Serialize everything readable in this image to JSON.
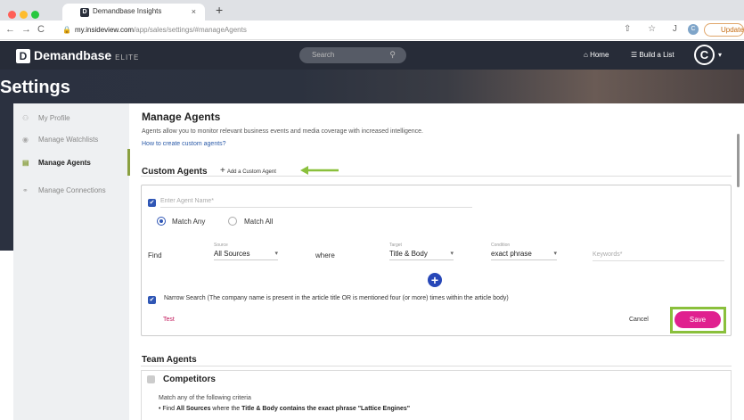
{
  "browser": {
    "tab_title": "Demandbase Insights",
    "tab_favicon": "D",
    "close_tab": "×",
    "new_tab": "+",
    "back_icon": "←",
    "forward_icon": "→",
    "reload_icon": "C",
    "lock_icon": "🔒",
    "url_domain": "my.insideview.com",
    "url_path": "/app/sales/settings/#manageAgents",
    "toolbar_icons": "⇧ ☆ J ♦",
    "profile_initial": "C",
    "update_label": "Update",
    "dot_colors": [
      "#ff5f57",
      "#febc2e",
      "#28c840"
    ]
  },
  "app": {
    "logo_mark": "D",
    "logo_text": "Demandbase",
    "logo_edition": "ELITE",
    "search_placeholder": "Search",
    "search_icon": "⚲",
    "home_icon": "⌂",
    "home_label": "Home",
    "list_icon": "☰",
    "build_label": "Build a List",
    "avatar_initial": "C",
    "avatar_caret": "▾",
    "page_title": "Settings"
  },
  "sidebar": {
    "items": [
      {
        "icon": "user-gear-icon",
        "glyph": "⚇",
        "label": "My Profile"
      },
      {
        "icon": "eye-icon",
        "glyph": "◉",
        "label": "Manage Watchlists"
      },
      {
        "icon": "agents-icon",
        "glyph": "▤",
        "label": "Manage Agents"
      },
      {
        "icon": "connections-icon",
        "glyph": "⚭",
        "label": "Manage Connections"
      }
    ]
  },
  "main": {
    "title": "Manage Agents",
    "description": "Agents allow you to monitor relevant business events and media coverage with increased intelligence.",
    "howto_link": "How to create custom agents?",
    "custom_title": "Custom Agents",
    "add_plus": "+",
    "add_custom": "Add a Custom Agent"
  },
  "form": {
    "check_mark": "✔",
    "agent_name_placeholder": "Enter Agent Name*",
    "match_any": "Match Any",
    "match_all": "Match All",
    "find": "Find",
    "source_label": "Source",
    "source_value": "All Sources",
    "where": "where",
    "target_label": "Target",
    "target_value": "Title & Body",
    "condition_label": "Condition",
    "condition_value": "exact phrase",
    "dropdown_arrow": "▾",
    "keywords_placeholder": "Keywords*",
    "add_criteria": "+",
    "narrow_search": "Narrow Search (The company name is present in the article title OR is mentioned four (or more) times within the article body)",
    "test": "Test",
    "cancel": "Cancel",
    "save": "Save"
  },
  "team": {
    "title": "Team Agents",
    "agent_name": "Competitors",
    "criteria_intro": "Match any of the following criteria",
    "criteria_bullet": "•",
    "criteria_find": "Find ",
    "criteria_source": "All Sources",
    "criteria_where": " where the ",
    "criteria_target": "Title & Body",
    "criteria_rest": " contains the exact phrase \"Lattice Engines\""
  },
  "colors": {
    "accent_green": "#8ac03c",
    "save_pink": "#e0208f",
    "primary_blue": "#2f56b5",
    "nav_bg": "#272c38"
  }
}
